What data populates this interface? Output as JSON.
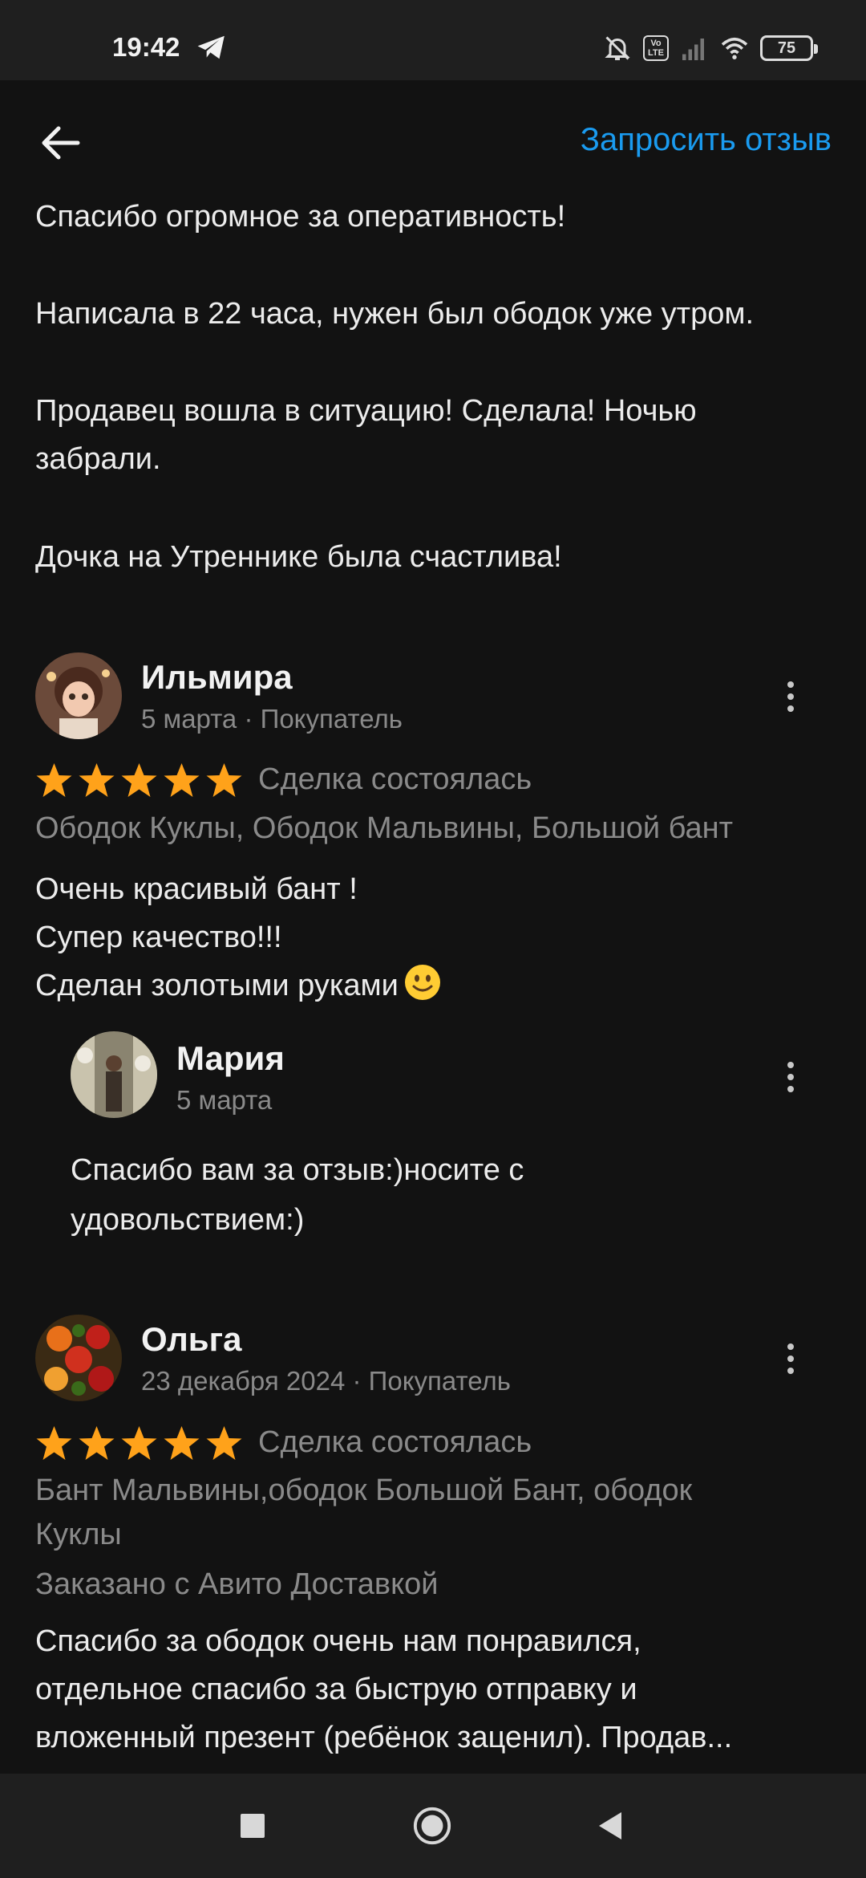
{
  "status_bar": {
    "time": "19:42",
    "battery": "75",
    "volte": "Vo LTE",
    "icons": [
      "telegram-icon",
      "bell-muted-icon",
      "volte-icon",
      "signal-icon",
      "wifi-icon",
      "battery-icon"
    ]
  },
  "header": {
    "back_icon": "arrow-left-icon",
    "request_label": "Запросить отзыв",
    "accent_color": "#1a9bf0"
  },
  "top_review_text": {
    "p1": "Спасибо огромное за оперативность!",
    "p2": "Написала в 22 часа, нужен был ободок уже утром.",
    "p3_line1": "Продавец вошла в ситуацию! Сделала! Ночью",
    "p3_line2": "забрали.",
    "p4": "Дочка на Утреннике была счастлива!"
  },
  "reviews": [
    {
      "author": "Ильмира",
      "meta": "5 марта · Покупатель",
      "rating": 5,
      "status": "Сделка состоялась",
      "items": "Ободок Куклы, Ободок Мальвины, Большой бант",
      "text_lines": [
        "Очень красивый бант !",
        "Супер качество!!!",
        "Сделан золотыми руками"
      ],
      "reply": {
        "author": "Мария",
        "meta": "5 марта",
        "text_line1": "Спасибо вам за отзыв:)носите с",
        "text_line2": "удовольствием:)"
      }
    },
    {
      "author": "Ольга",
      "meta": "23 декабря 2024 · Покупатель",
      "rating": 5,
      "status": "Сделка состоялась",
      "items_line1": "Бант Мальвины,ободок Большой Бант, ободок",
      "items_line2": "Куклы",
      "delivery": "Заказано с Авито Доставкой",
      "text_lines": [
        "Спасибо за ободок очень нам понравился,",
        "отдельное спасибо за быструю отправку и",
        "вложенный презент (ребёнок заценил). Продав..."
      ]
    }
  ],
  "star_color": "#ffa21a",
  "navbar": {
    "icons": [
      "recents-square-icon",
      "home-circle-icon",
      "back-triangle-icon"
    ]
  }
}
